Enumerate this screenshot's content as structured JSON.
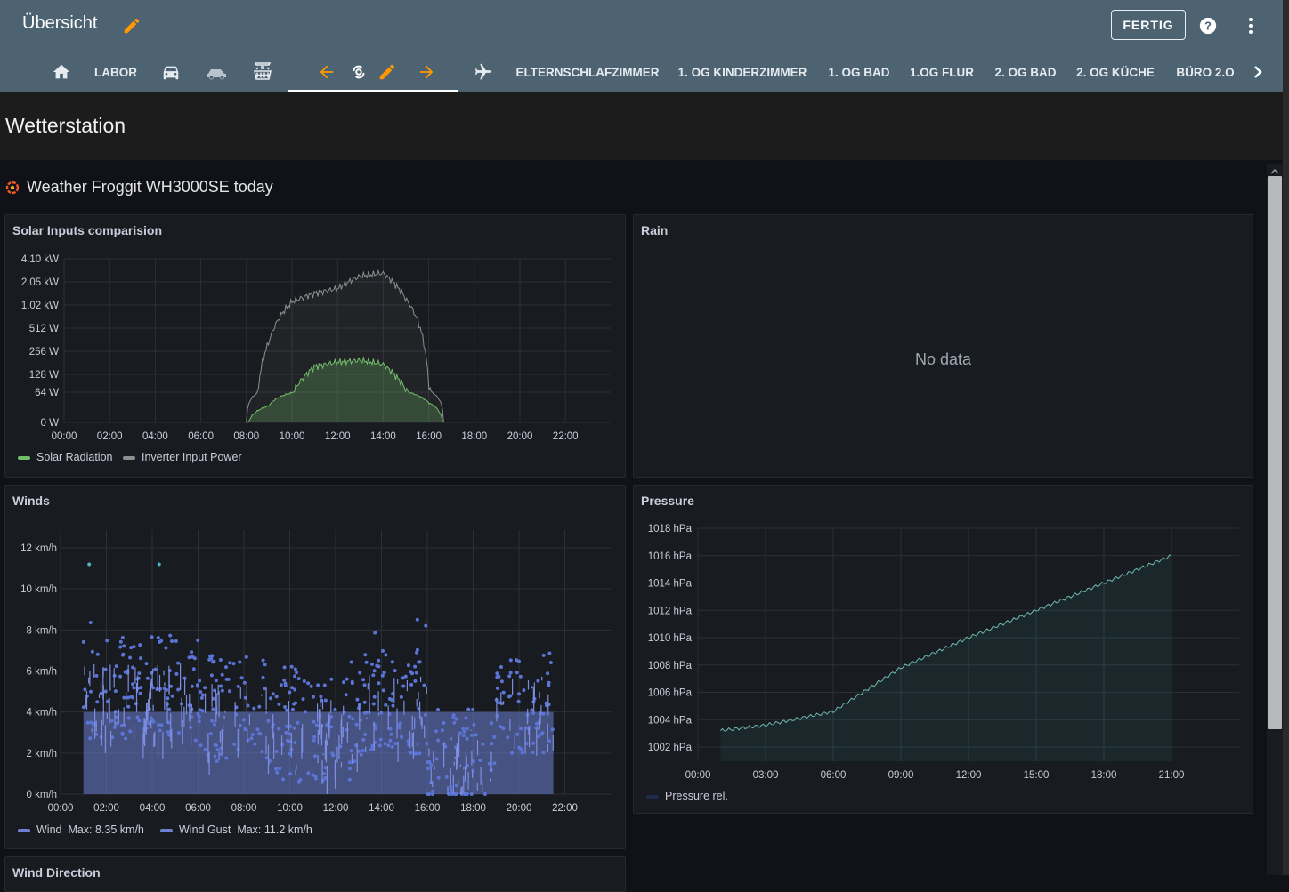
{
  "header": {
    "title": "Übersicht",
    "done_label": "FERTIG",
    "tabs": [
      "LABOR",
      "ELTERNSCHLAFZIMMER",
      "1. OG KINDERZIMMER",
      "1. OG BAD",
      "1.OG FLUR",
      "2. OG BAD",
      "2. OG KÜCHE",
      "BÜRO 2.O"
    ]
  },
  "view_title": "Wetterstation",
  "dashboard": {
    "title": "Weather Froggit WH3000SE today",
    "panels": {
      "solar": {
        "title": "Solar Inputs comparision",
        "legend": [
          "Solar Radiation",
          "Inverter Input Power"
        ]
      },
      "rain": {
        "title": "Rain",
        "no_data": "No data"
      },
      "winds": {
        "title": "Winds",
        "legend": [
          "Wind",
          "Max: 8.35 km/h",
          "Wind Gust",
          "Max: 11.2 km/h"
        ]
      },
      "pressure": {
        "title": "Pressure",
        "legend": [
          "Pressure rel."
        ]
      },
      "wind_direction": {
        "title": "Wind Direction"
      }
    }
  },
  "colors": {
    "header_bg": "#4d6372",
    "accent": "#ff9800",
    "solar": "#73bf69",
    "inverter": "#8e8e8e",
    "wind": "#6e7fd4",
    "pressure": "#2a8c8c"
  },
  "chart_data": [
    {
      "type": "line",
      "title": "Solar Inputs comparision",
      "yscale": "log",
      "y_ticks": [
        "4.10 kW",
        "2.05 kW",
        "1.02 kW",
        "512 W",
        "256 W",
        "128 W",
        "64 W",
        "0 W"
      ],
      "x_ticks": [
        "00:00",
        "02:00",
        "04:00",
        "06:00",
        "08:00",
        "10:00",
        "12:00",
        "14:00",
        "16:00",
        "18:00",
        "20:00",
        "22:00"
      ],
      "series": [
        {
          "name": "Solar Radiation",
          "unit": "W",
          "x": [
            "08:00",
            "09:00",
            "10:00",
            "11:00",
            "12:00",
            "13:00",
            "14:00",
            "15:00",
            "16:00",
            "16:40"
          ],
          "values": [
            0,
            10,
            60,
            140,
            160,
            170,
            150,
            70,
            15,
            0
          ]
        },
        {
          "name": "Inverter Input Power",
          "unit": "W",
          "x": [
            "08:00",
            "08:30",
            "09:00",
            "10:00",
            "11:00",
            "12:00",
            "13:00",
            "14:00",
            "15:00",
            "16:00",
            "16:40"
          ],
          "values": [
            0,
            60,
            300,
            1000,
            1300,
            1500,
            2200,
            2400,
            1100,
            80,
            0
          ]
        }
      ]
    },
    {
      "type": "scatter",
      "title": "Winds",
      "y_ticks": [
        "12 km/h",
        "10 km/h",
        "8 km/h",
        "6 km/h",
        "4 km/h",
        "2 km/h",
        "0 km/h"
      ],
      "x_ticks": [
        "00:00",
        "02:00",
        "04:00",
        "06:00",
        "08:00",
        "10:00",
        "12:00",
        "14:00",
        "16:00",
        "18:00",
        "20:00",
        "22:00"
      ],
      "ylim": [
        0,
        12.5
      ],
      "series": [
        {
          "name": "Wind",
          "max": 8.35,
          "unit": "km/h"
        },
        {
          "name": "Wind Gust",
          "max": 11.2,
          "unit": "km/h"
        }
      ]
    },
    {
      "type": "area",
      "title": "Pressure",
      "y_ticks": [
        "1018 hPa",
        "1016 hPa",
        "1014 hPa",
        "1012 hPa",
        "1010 hPa",
        "1008 hPa",
        "1006 hPa",
        "1004 hPa",
        "1002 hPa"
      ],
      "x_ticks": [
        "00:00",
        "03:00",
        "06:00",
        "09:00",
        "12:00",
        "15:00",
        "18:00",
        "21:00"
      ],
      "series": [
        {
          "name": "Pressure rel.",
          "x": [
            "01:00",
            "03:00",
            "06:00",
            "09:00",
            "12:00",
            "15:00",
            "18:00",
            "21:00"
          ],
          "values": [
            1003.2,
            1003.6,
            1004.6,
            1007.8,
            1010.0,
            1012.0,
            1014.0,
            1016.0
          ]
        }
      ]
    }
  ]
}
